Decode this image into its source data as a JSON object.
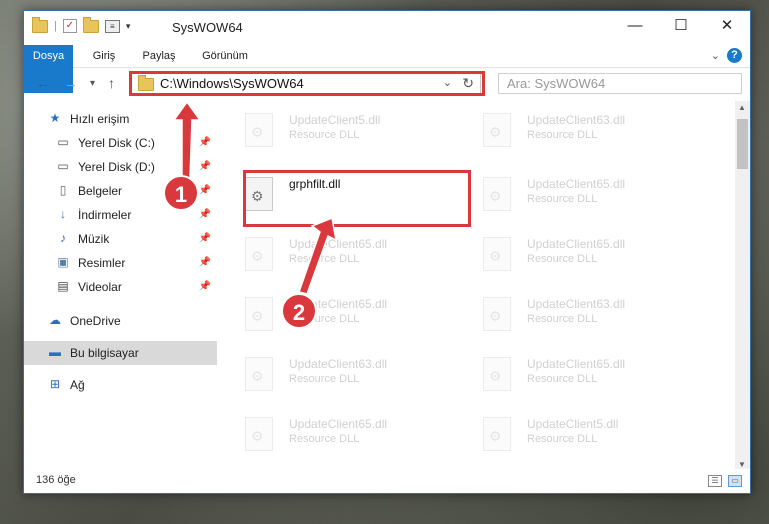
{
  "window": {
    "title": "SysWOW64",
    "buttons": {
      "minimize": "—",
      "maximize": "☐",
      "close": "✕"
    }
  },
  "ribbon": {
    "tabs": [
      "Dosya",
      "Giriş",
      "Paylaş",
      "Görünüm"
    ],
    "help": "?",
    "expand": "⌄"
  },
  "address": {
    "path": "C:\\Windows\\SysWOW64",
    "search_placeholder": "Ara: SysWOW64"
  },
  "nav": {
    "quick_access": "Hızlı erişim",
    "items": [
      {
        "label": "Yerel Disk (C:)",
        "icon": "drive-icon"
      },
      {
        "label": "Yerel Disk (D:)",
        "icon": "drive-icon"
      },
      {
        "label": "Belgeler",
        "icon": "documents-icon"
      },
      {
        "label": "İndirmeler",
        "icon": "download-icon"
      },
      {
        "label": "Müzik",
        "icon": "music-icon"
      },
      {
        "label": "Resimler",
        "icon": "pictures-icon"
      },
      {
        "label": "Videolar",
        "icon": "videos-icon"
      }
    ],
    "onedrive": "OneDrive",
    "this_pc": "Bu bilgisayar",
    "network": "Ağ"
  },
  "files": {
    "left": [
      {
        "name": "UpdateClient5.dll",
        "type": "Resource DLL"
      },
      {
        "name": "grphfilt.dll",
        "type": ""
      },
      {
        "name": "UpdateClient65.dll",
        "type": "Resource DLL"
      },
      {
        "name": "UpdateClient65.dll",
        "type": "Resource DLL"
      },
      {
        "name": "UpdateClient63.dll",
        "type": "Resource DLL"
      },
      {
        "name": "UpdateClient65.dll",
        "type": "Resource DLL"
      }
    ],
    "right": [
      {
        "name": "UpdateClient63.dll",
        "type": "Resource DLL"
      },
      {
        "name": "UpdateClient65.dll",
        "type": "Resource DLL"
      },
      {
        "name": "UpdateClient65.dll",
        "type": "Resource DLL"
      },
      {
        "name": "UpdateClient63.dll",
        "type": "Resource DLL"
      },
      {
        "name": "UpdateClient65.dll",
        "type": "Resource DLL"
      },
      {
        "name": "UpdateClient5.dll",
        "type": "Resource DLL"
      }
    ]
  },
  "status": {
    "count": "136 öğe"
  },
  "annotations": {
    "step1": "1",
    "step2": "2"
  },
  "colors": {
    "accent": "#1979ca",
    "highlight": "#d9383c"
  }
}
